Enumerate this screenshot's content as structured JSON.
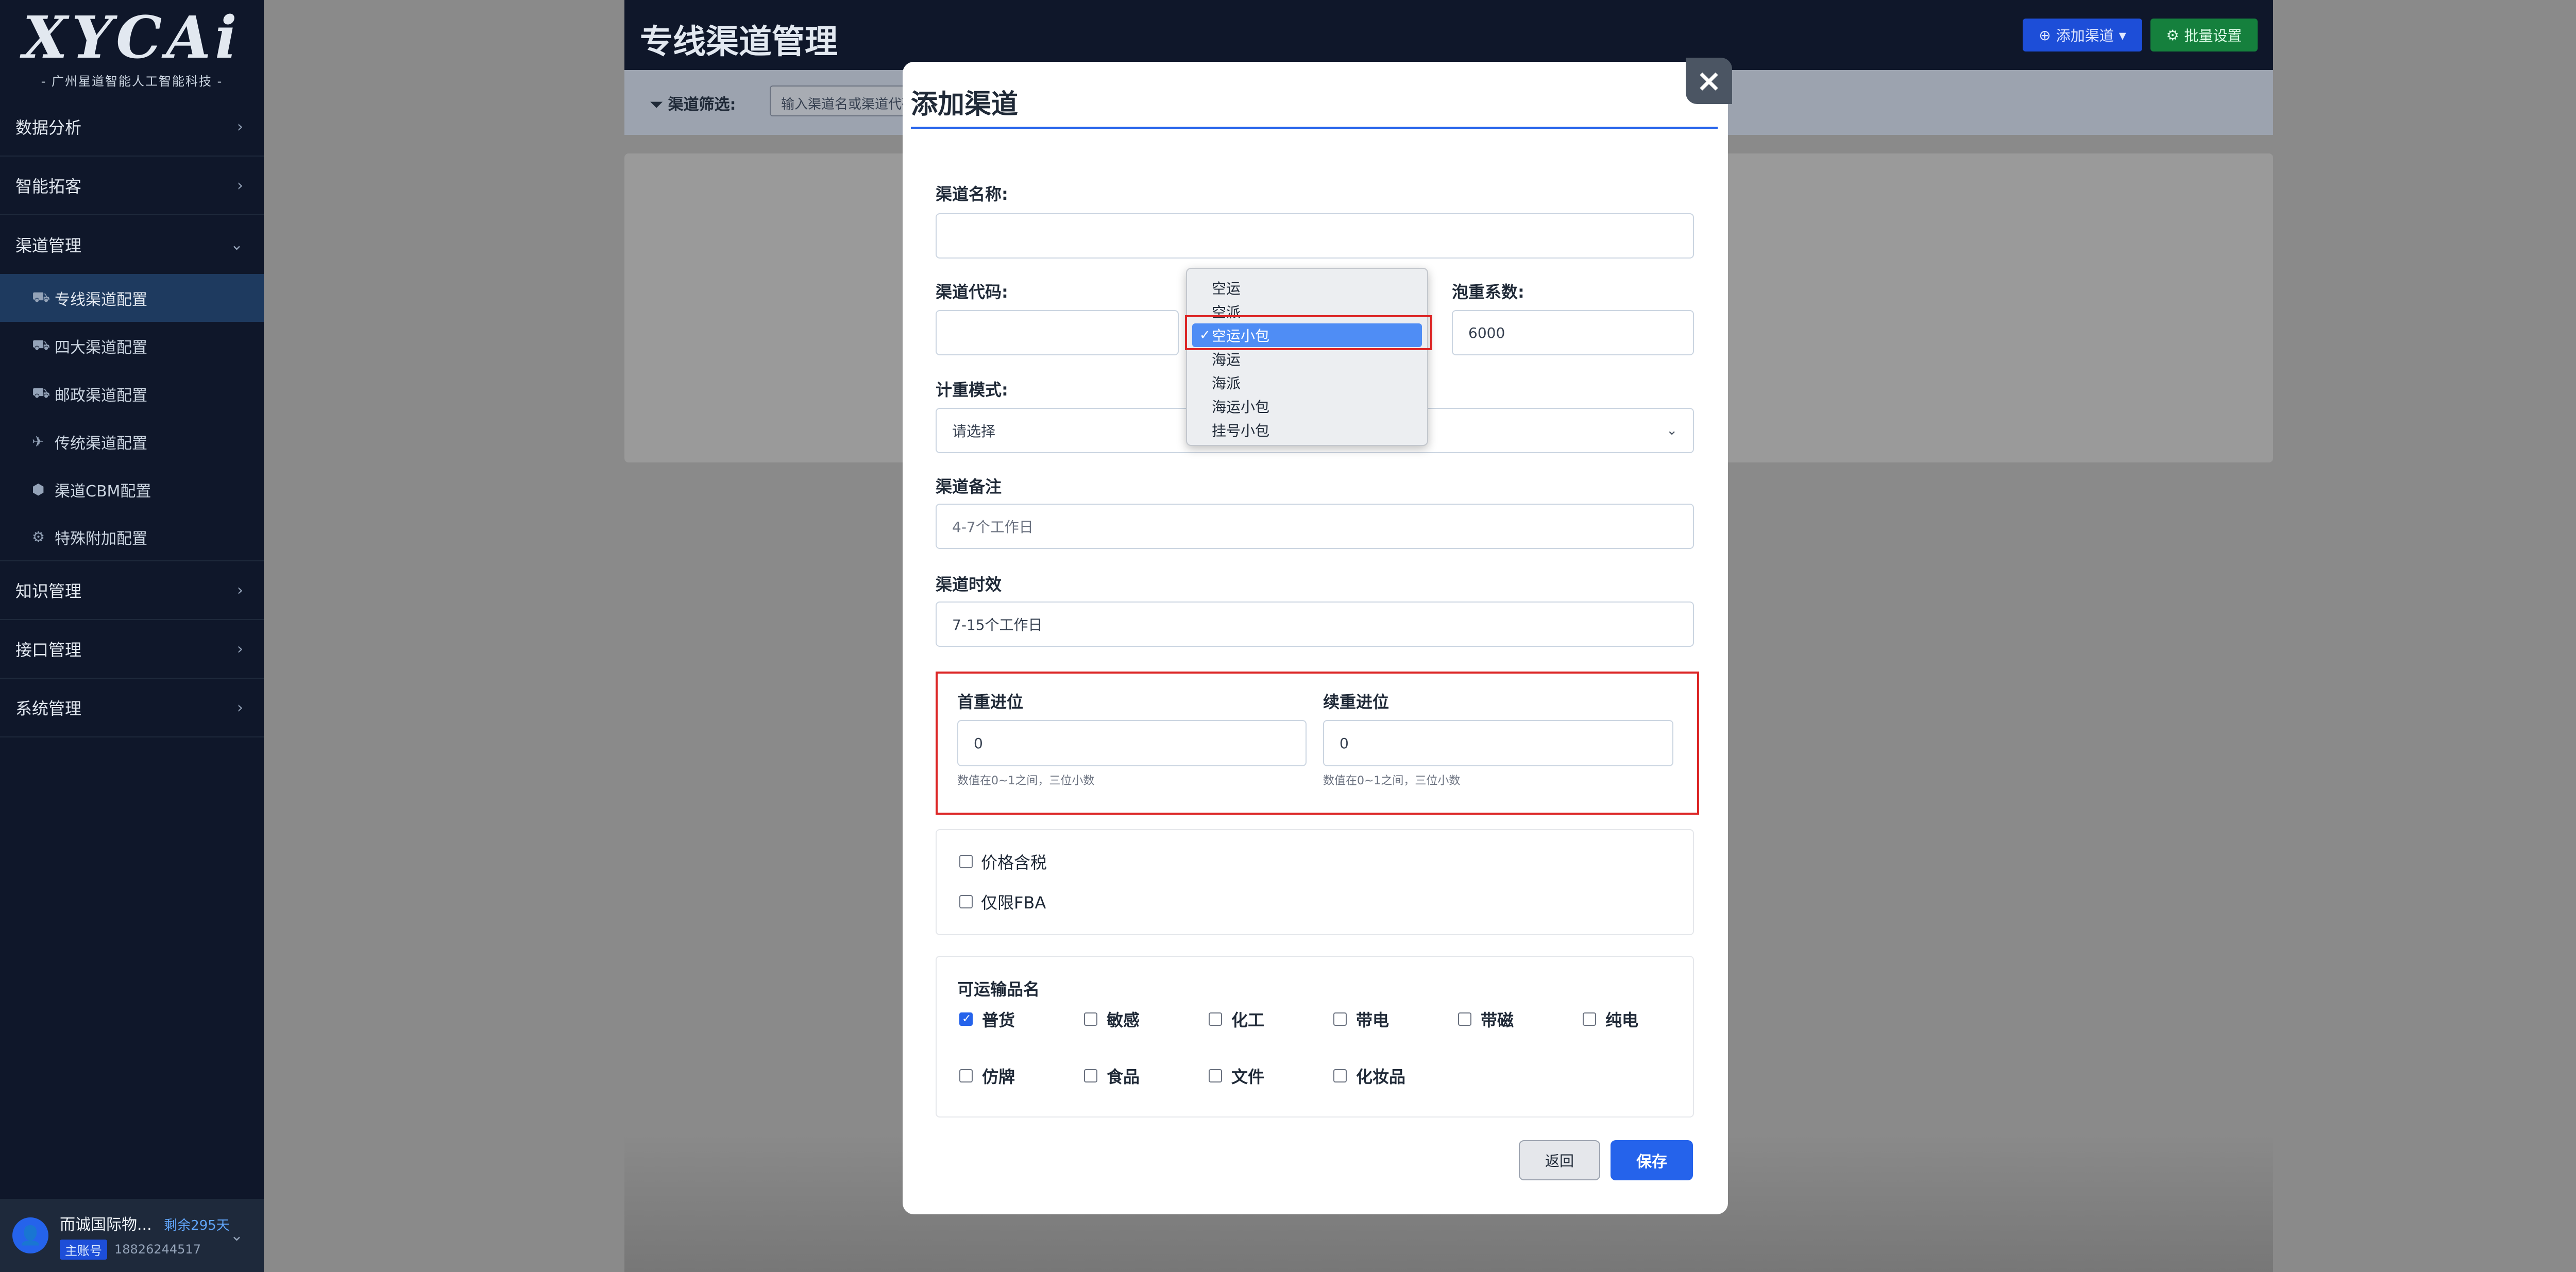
{
  "sidebar": {
    "logo": "XYCAi",
    "logo_sub": "- 广州星道智能人工智能科技 -",
    "groups": [
      {
        "label": "数据分析"
      },
      {
        "label": "智能拓客"
      },
      {
        "label": "渠道管理"
      },
      {
        "label": "知识管理"
      },
      {
        "label": "接口管理"
      },
      {
        "label": "系统管理"
      }
    ],
    "submenu": [
      {
        "label": "专线渠道配置",
        "icon": "truck-icon"
      },
      {
        "label": "四大渠道配置",
        "icon": "truck-icon"
      },
      {
        "label": "邮政渠道配置",
        "icon": "truck-icon"
      },
      {
        "label": "传统渠道配置",
        "icon": "plane-icon"
      },
      {
        "label": "渠道CBM配置",
        "icon": "box-icon"
      },
      {
        "label": "特殊附加配置",
        "icon": "gear-icon"
      }
    ],
    "user": {
      "name": "而诚国际物...",
      "days": "剩余295天",
      "tag": "主账号",
      "phone": "18826244517"
    }
  },
  "header": {
    "title": "专线渠道管理",
    "add_button": "添加渠道",
    "batch_button": "批量设置"
  },
  "filter": {
    "label": "渠道筛选:",
    "placeholder": "输入渠道名或渠道代码"
  },
  "modal": {
    "title": "添加渠道",
    "close": "×",
    "channel_name_label": "渠道名称:",
    "channel_name_value": "",
    "channel_code_label": "渠道代码:",
    "channel_code_value": "",
    "volume_factor_label": "泡重系数:",
    "volume_factor_value": "6000",
    "weight_mode_label": "计重模式:",
    "weight_mode_value": "请选择",
    "remark_label": "渠道备注",
    "remark_placeholder": "4-7个工作日",
    "timeliness_label": "渠道时效",
    "timeliness_value": "7-15个工作日",
    "first_weight_label": "首重进位",
    "first_weight_value": "0",
    "first_weight_help": "数值在0~1之间，三位小数",
    "extra_weight_label": "续重进位",
    "extra_weight_value": "0",
    "extra_weight_help": "数值在0~1之间，三位小数",
    "tax_label": "价格含税",
    "fba_label": "仅限FBA",
    "cargo_title": "可运输品名",
    "cargo": [
      {
        "label": "普货",
        "checked": true
      },
      {
        "label": "敏感",
        "checked": false
      },
      {
        "label": "化工",
        "checked": false
      },
      {
        "label": "带电",
        "checked": false
      },
      {
        "label": "带磁",
        "checked": false
      },
      {
        "label": "纯电",
        "checked": false
      },
      {
        "label": "仿牌",
        "checked": false
      },
      {
        "label": "食品",
        "checked": false
      },
      {
        "label": "文件",
        "checked": false
      },
      {
        "label": "化妆品",
        "checked": false
      }
    ],
    "back_button": "返回",
    "save_button": "保存"
  },
  "dropdown": {
    "options": [
      "空运",
      "空派",
      "空运小包",
      "海运",
      "海派",
      "海运小包",
      "挂号小包"
    ],
    "selected": "空运小包"
  },
  "colors": {
    "primary": "#2563eb",
    "sidebar_bg": "#0f172a",
    "highlight_red": "#dc2626",
    "success": "#15803d"
  }
}
